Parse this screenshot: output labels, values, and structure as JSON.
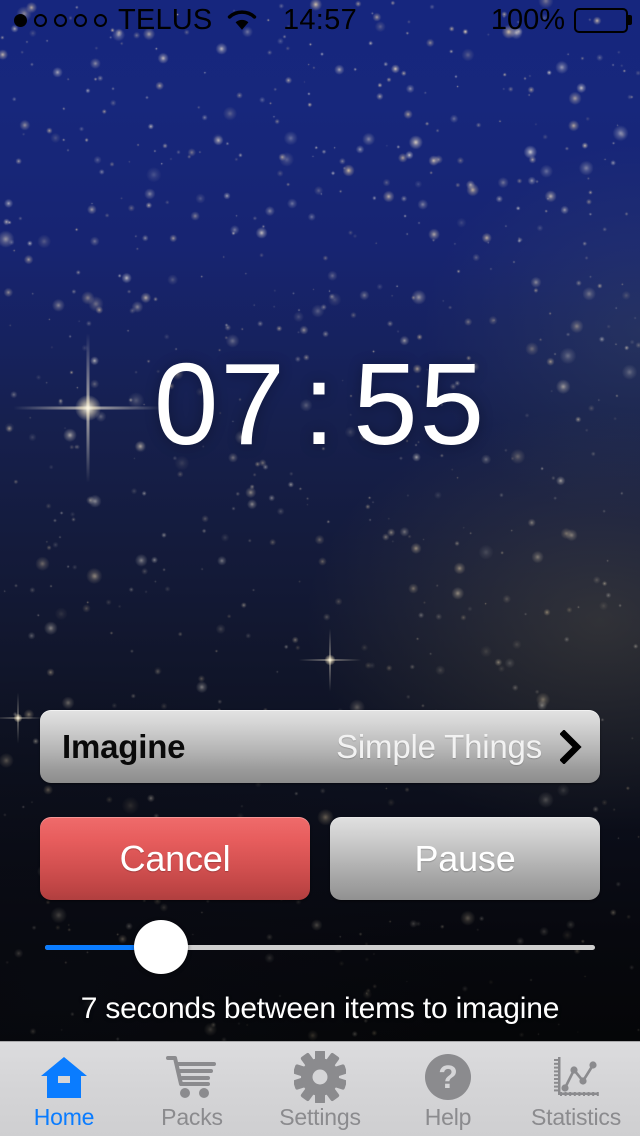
{
  "status_bar": {
    "signal_dots_total": 5,
    "signal_dots_filled": 1,
    "carrier": "TELUS",
    "wifi_icon": "wifi-icon",
    "time": "14:57",
    "battery_percent": "100%",
    "battery_icon": "battery-full-icon"
  },
  "timer": {
    "minutes": "07",
    "separator": ":",
    "seconds": "55",
    "full": "07 : 55"
  },
  "imagine_row": {
    "label": "Imagine",
    "value": "Simple Things",
    "disclosure_icon": "chevron-right-icon"
  },
  "actions": {
    "cancel_label": "Cancel",
    "pause_label": "Pause"
  },
  "slider": {
    "value_percent": 21,
    "caption": "7 seconds between items to imagine",
    "seconds": "7"
  },
  "tab_bar": {
    "active": "Home",
    "items": [
      {
        "label": "Home",
        "icon": "house-icon",
        "active": true
      },
      {
        "label": "Packs",
        "icon": "shopping-cart-icon",
        "active": false
      },
      {
        "label": "Settings",
        "icon": "gear-icon",
        "active": false
      },
      {
        "label": "Help",
        "icon": "question-mark-circle-icon",
        "active": false
      },
      {
        "label": "Statistics",
        "icon": "line-chart-icon",
        "active": false
      }
    ]
  },
  "colors": {
    "accent_blue": "#0a7cff",
    "cancel_red": "#e05050",
    "sky_top": "#16267e",
    "sky_bottom": "#050608",
    "tabbar_bg": "#d5d5d7",
    "tab_inactive": "#8b8b8e"
  }
}
